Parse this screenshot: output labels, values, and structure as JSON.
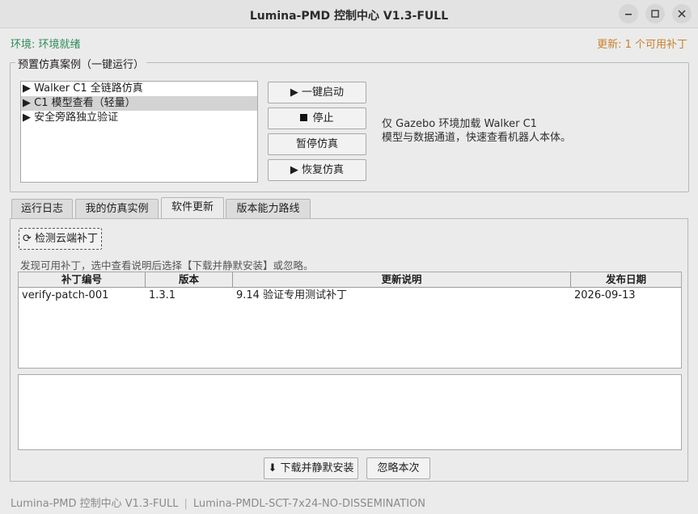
{
  "window": {
    "title": "Lumina-PMD 控制中心  V1.3-FULL",
    "controls": {
      "minimize": "minimize-icon",
      "maximize": "maximize-icon",
      "close": "close-icon"
    }
  },
  "status": {
    "environment": "环境: 环境就绪",
    "update": "更新: 1 个可用补丁",
    "environment_color": "#2e8b57",
    "update_color": "#c9822d"
  },
  "presets": {
    "legend": "预置仿真案例（一键运行）",
    "items": [
      {
        "label": "▶ Walker C1 全链路仿真",
        "selected": false
      },
      {
        "label": "▶ C1 模型查看（轻量）",
        "selected": true
      },
      {
        "label": "▶ 安全旁路独立验证",
        "selected": false
      }
    ],
    "buttons": {
      "start": "▶ 一键启动",
      "stop": "停止",
      "pause": "暂停仿真",
      "resume": "▶ 恢复仿真"
    },
    "description_line1": "仅 Gazebo 环境加载 Walker C1",
    "description_line2": "模型与数据通道，快速查看机器人本体。"
  },
  "tabs": [
    {
      "label": "运行日志",
      "active": false
    },
    {
      "label": "我的仿真实例",
      "active": false
    },
    {
      "label": "软件更新",
      "active": true
    },
    {
      "label": "版本能力路线",
      "active": false
    }
  ],
  "update_panel": {
    "check_button": "⟳ 检测云端补丁",
    "hint": "发现可用补丁，选中查看说明后选择【下载并静默安装】或忽略。",
    "columns": [
      "补丁编号",
      "版本",
      "更新说明",
      "发布日期"
    ],
    "rows": [
      [
        "verify-patch-001",
        "1.3.1",
        "9.14 验证专用测试补丁",
        "2026-09-13"
      ]
    ],
    "detail_text": "",
    "download_button": "⬇ 下载并静默安装",
    "ignore_button": "忽略本次"
  },
  "footer": {
    "left": "Lumina-PMD 控制中心 V1.3-FULL",
    "separator": "|",
    "right": "Lumina-PMDL-SCT-7x24-NO-DISSEMINATION"
  }
}
